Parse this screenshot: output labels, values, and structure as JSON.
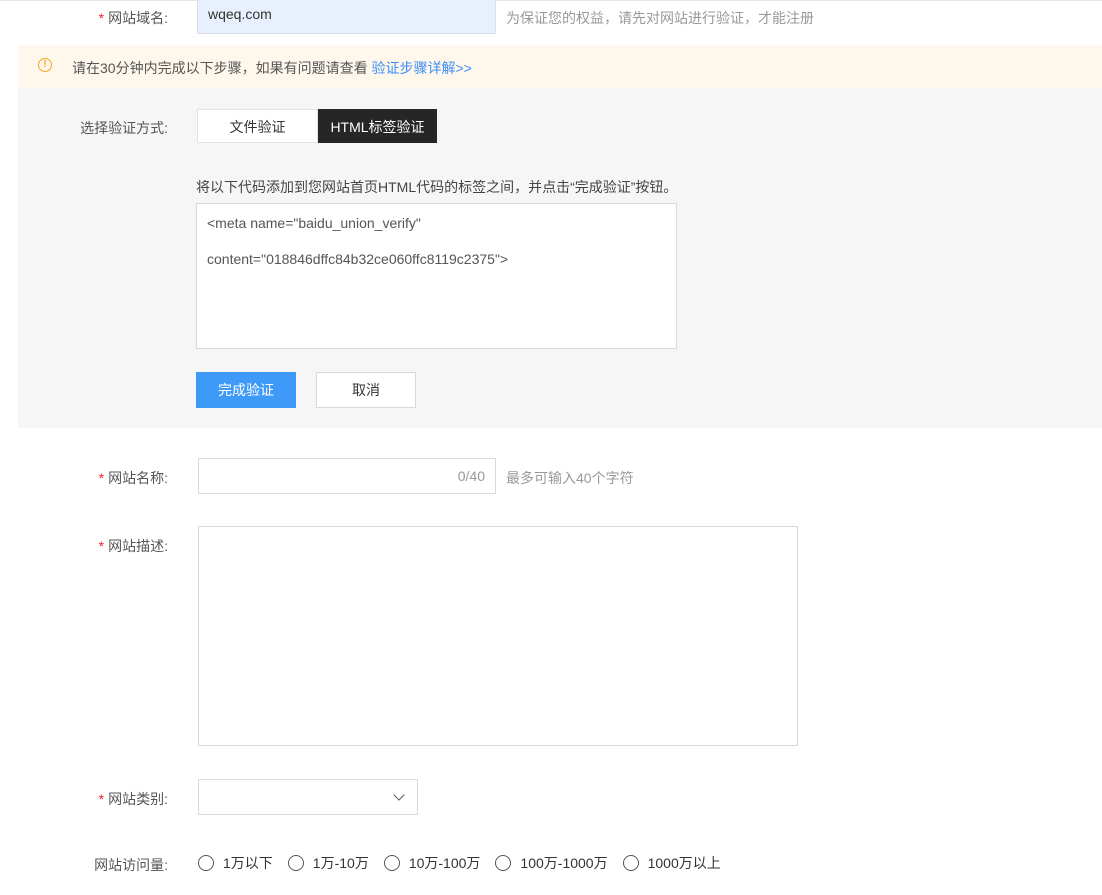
{
  "domain": {
    "label": "网站域名:",
    "value": "wqeq.com",
    "hint": "为保证您的权益，请先对网站进行验证，才能注册"
  },
  "notice": {
    "text": "请在30分钟内完成以下步骤，如果有问题请查看 ",
    "link": "验证步骤详解>>",
    "icon": "warning-circle-icon",
    "accent": "#f5a623"
  },
  "verify": {
    "label": "选择验证方式:",
    "methods": [
      "文件验证",
      "HTML标签验证"
    ],
    "selected": "HTML标签验证",
    "instruction": "将以下代码添加到您网站首页HTML代码的标签之间，并点击“完成验证”按钮。",
    "code_line1": "<meta name=\"baidu_union_verify\"",
    "code_line2": "content=\"018846dffc84b32ce060ffc8119c2375\">",
    "submit_label": "完成验证",
    "cancel_label": "取消",
    "primary_color": "#3e9af7"
  },
  "site_name": {
    "label": "网站名称:",
    "counter": "0/40",
    "hint": "最多可输入40个字符"
  },
  "site_desc": {
    "label": "网站描述:"
  },
  "site_category": {
    "label": "网站类别:",
    "icon": "chevron-down-icon"
  },
  "traffic": {
    "label": "网站访问量:",
    "options": [
      "1万以下",
      "1万-10万",
      "10万-100万",
      "100万-1000万",
      "1000万以上"
    ]
  }
}
